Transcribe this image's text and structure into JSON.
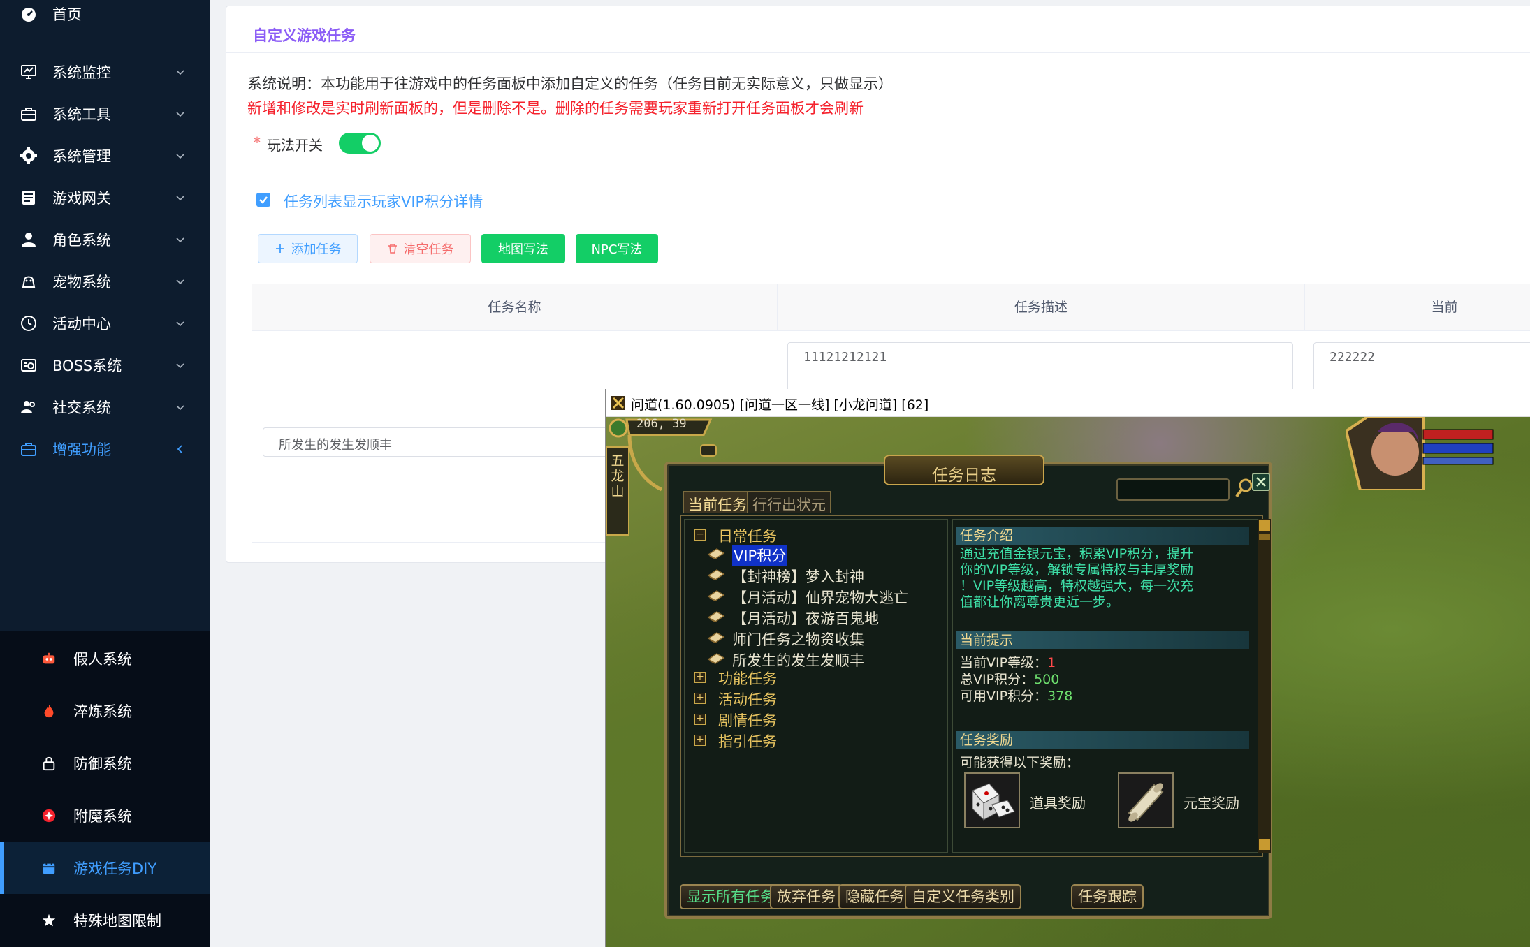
{
  "sidebar": {
    "items": [
      {
        "label": "首页",
        "icon": "dashboard-icon",
        "caret": false
      },
      {
        "label": "系统监控",
        "icon": "monitor-icon",
        "caret": true
      },
      {
        "label": "系统工具",
        "icon": "toolbox-icon",
        "caret": true
      },
      {
        "label": "系统管理",
        "icon": "gear-icon",
        "caret": true
      },
      {
        "label": "游戏网关",
        "icon": "server-icon",
        "caret": true
      },
      {
        "label": "角色系统",
        "icon": "user-icon",
        "caret": true
      },
      {
        "label": "宠物系统",
        "icon": "pet-icon",
        "caret": true
      },
      {
        "label": "活动中心",
        "icon": "clock-icon",
        "caret": true
      },
      {
        "label": "BOSS系统",
        "icon": "boss-icon",
        "caret": true
      },
      {
        "label": "社交系统",
        "icon": "people-icon",
        "caret": true
      },
      {
        "label": "增强功能",
        "icon": "toolbox-icon",
        "caret": true,
        "expanded": true
      }
    ],
    "sub_items": [
      {
        "label": "假人系统",
        "icon": "robot-icon"
      },
      {
        "label": "淬炼系统",
        "icon": "fire-icon"
      },
      {
        "label": "防御系统",
        "icon": "lock-icon"
      },
      {
        "label": "附魔系统",
        "icon": "magic-icon"
      },
      {
        "label": "游戏任务DIY",
        "icon": "calendar-icon",
        "active": true
      },
      {
        "label": "特殊地图限制",
        "icon": "star-icon"
      }
    ],
    "colors": {
      "bg": "#0d1c2e",
      "submenu_bg": "#060d18",
      "active": "#409eff"
    }
  },
  "card": {
    "title": "自定义游戏任务",
    "description": "系统说明：本功能用于往游戏中的任务面板中添加自定义的任务（任务目前无实际意义，只做显示）",
    "warning": "新增和修改是实时刷新面板的，但是删除不是。删除的任务需要玩家重新打开任务面板才会刷新",
    "switch_required_mark": "*",
    "switch_label": "玩法开关",
    "switch_on": true,
    "vip_checkbox_label": "任务列表显示玩家VIP积分详情",
    "vip_checkbox_checked": true,
    "buttons": {
      "add": "添加任务",
      "clear": "清空任务",
      "map": "地图写法",
      "npc": "NPC写法"
    },
    "table": {
      "headers": [
        "任务名称",
        "任务描述",
        "当前"
      ],
      "row": {
        "name": "所发生的发生发顺丰",
        "description": "11121212121",
        "current": "222222"
      }
    }
  },
  "game": {
    "window_title": "问道(1.60.0905)  [问道一区一线] [小龙问道] [62]",
    "coords": "206, 39",
    "map_name": "五龙山",
    "dialog": {
      "title": "任务日志",
      "tabs": [
        "当前任务",
        "行行出状元"
      ],
      "tree": {
        "daily_group": "日常任务",
        "daily_items": [
          "VIP积分",
          "【封神榜】梦入封神",
          "【月活动】仙界宠物大逃亡",
          "【月活动】夜游百鬼地",
          "师门任务之物资收集",
          "所发生的发生发顺丰"
        ],
        "selected_item": "VIP积分",
        "groups": [
          "功能任务",
          "活动任务",
          "剧情任务",
          "指引任务"
        ]
      },
      "intro_head": "任务介绍",
      "intro_lines": [
        "通过充值金银元宝，积累VIP积分，提升",
        "你的VIP等级，解锁专属特权与丰厚奖励",
        "！VIP等级越高，特权越强大，每一次充",
        "值都让你离尊贵更近一步。"
      ],
      "hint_head": "当前提示",
      "vip_level_label": "当前VIP等级：",
      "vip_level": "1",
      "vip_total_label": "总VIP积分：",
      "vip_total": "500",
      "vip_available_label": "可用VIP积分：",
      "vip_available": "378",
      "reward_head": "任务奖励",
      "reward_intro": "可能获得以下奖励：",
      "reward_item": "道具奖励",
      "reward_yuanbao": "元宝奖励",
      "buttons": {
        "show_all": "显示所有任务",
        "giveup": "放弃任务",
        "hide": "隐藏任务",
        "custom_category": "自定义任务类别",
        "track": "任务跟踪"
      }
    }
  }
}
